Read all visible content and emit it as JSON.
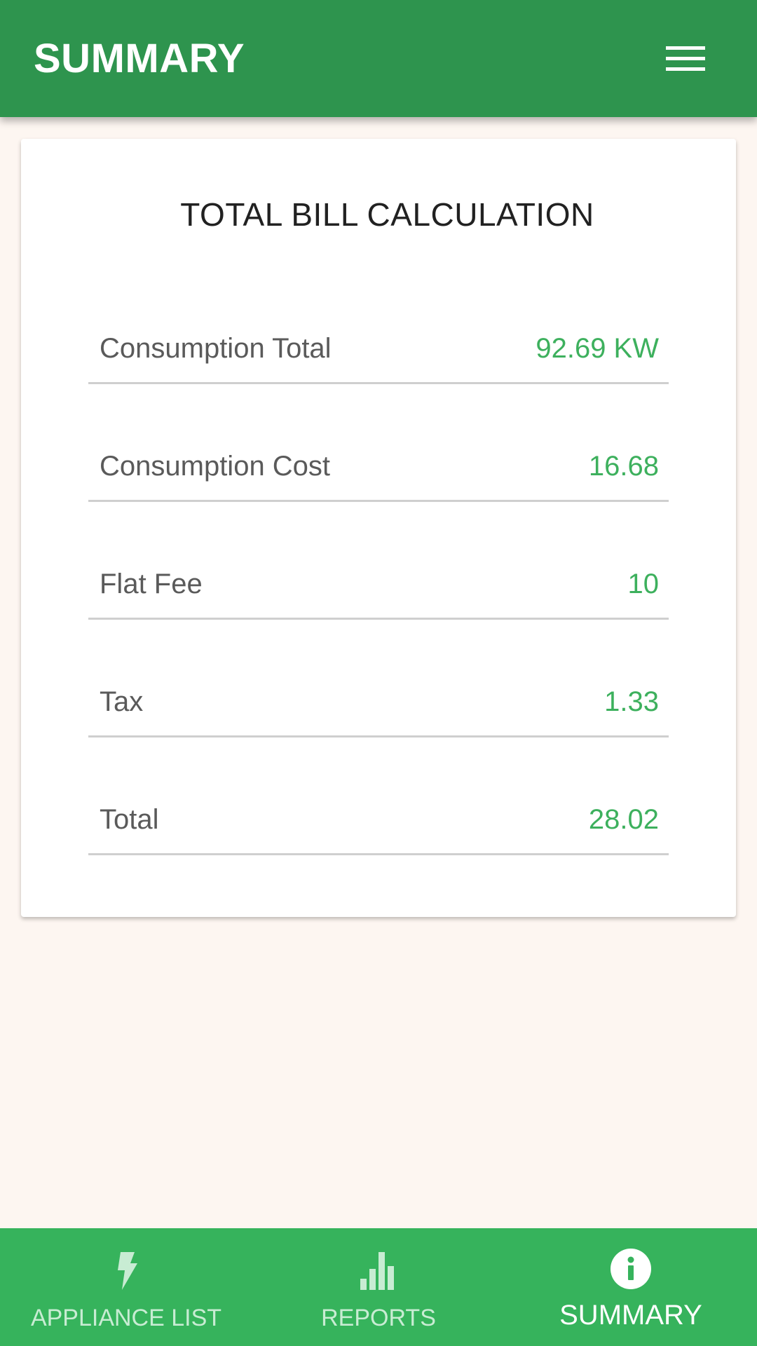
{
  "header": {
    "title": "SUMMARY",
    "menu_icon": "hamburger-menu-icon"
  },
  "card": {
    "title": "TOTAL BILL CALCULATION",
    "rows": [
      {
        "label": "Consumption Total",
        "value": "92.69 KW"
      },
      {
        "label": "Consumption Cost",
        "value": "16.68"
      },
      {
        "label": "Flat Fee",
        "value": "10"
      },
      {
        "label": "Tax",
        "value": "1.33"
      },
      {
        "label": "Total",
        "value": "28.02"
      }
    ]
  },
  "bottom_nav": {
    "items": [
      {
        "label": "APPLIANCE LIST",
        "icon": "lightning-bolt-icon",
        "active": false
      },
      {
        "label": "REPORTS",
        "icon": "bar-chart-icon",
        "active": false
      },
      {
        "label": "SUMMARY",
        "icon": "info-circle-icon",
        "active": true
      }
    ]
  },
  "colors": {
    "header_bg": "#2e944e",
    "nav_bg": "#36b35c",
    "value_text": "#3db05d",
    "page_bg": "#fdf6f1",
    "nav_inactive": "#c8ecd3",
    "nav_active": "#ffffff"
  }
}
